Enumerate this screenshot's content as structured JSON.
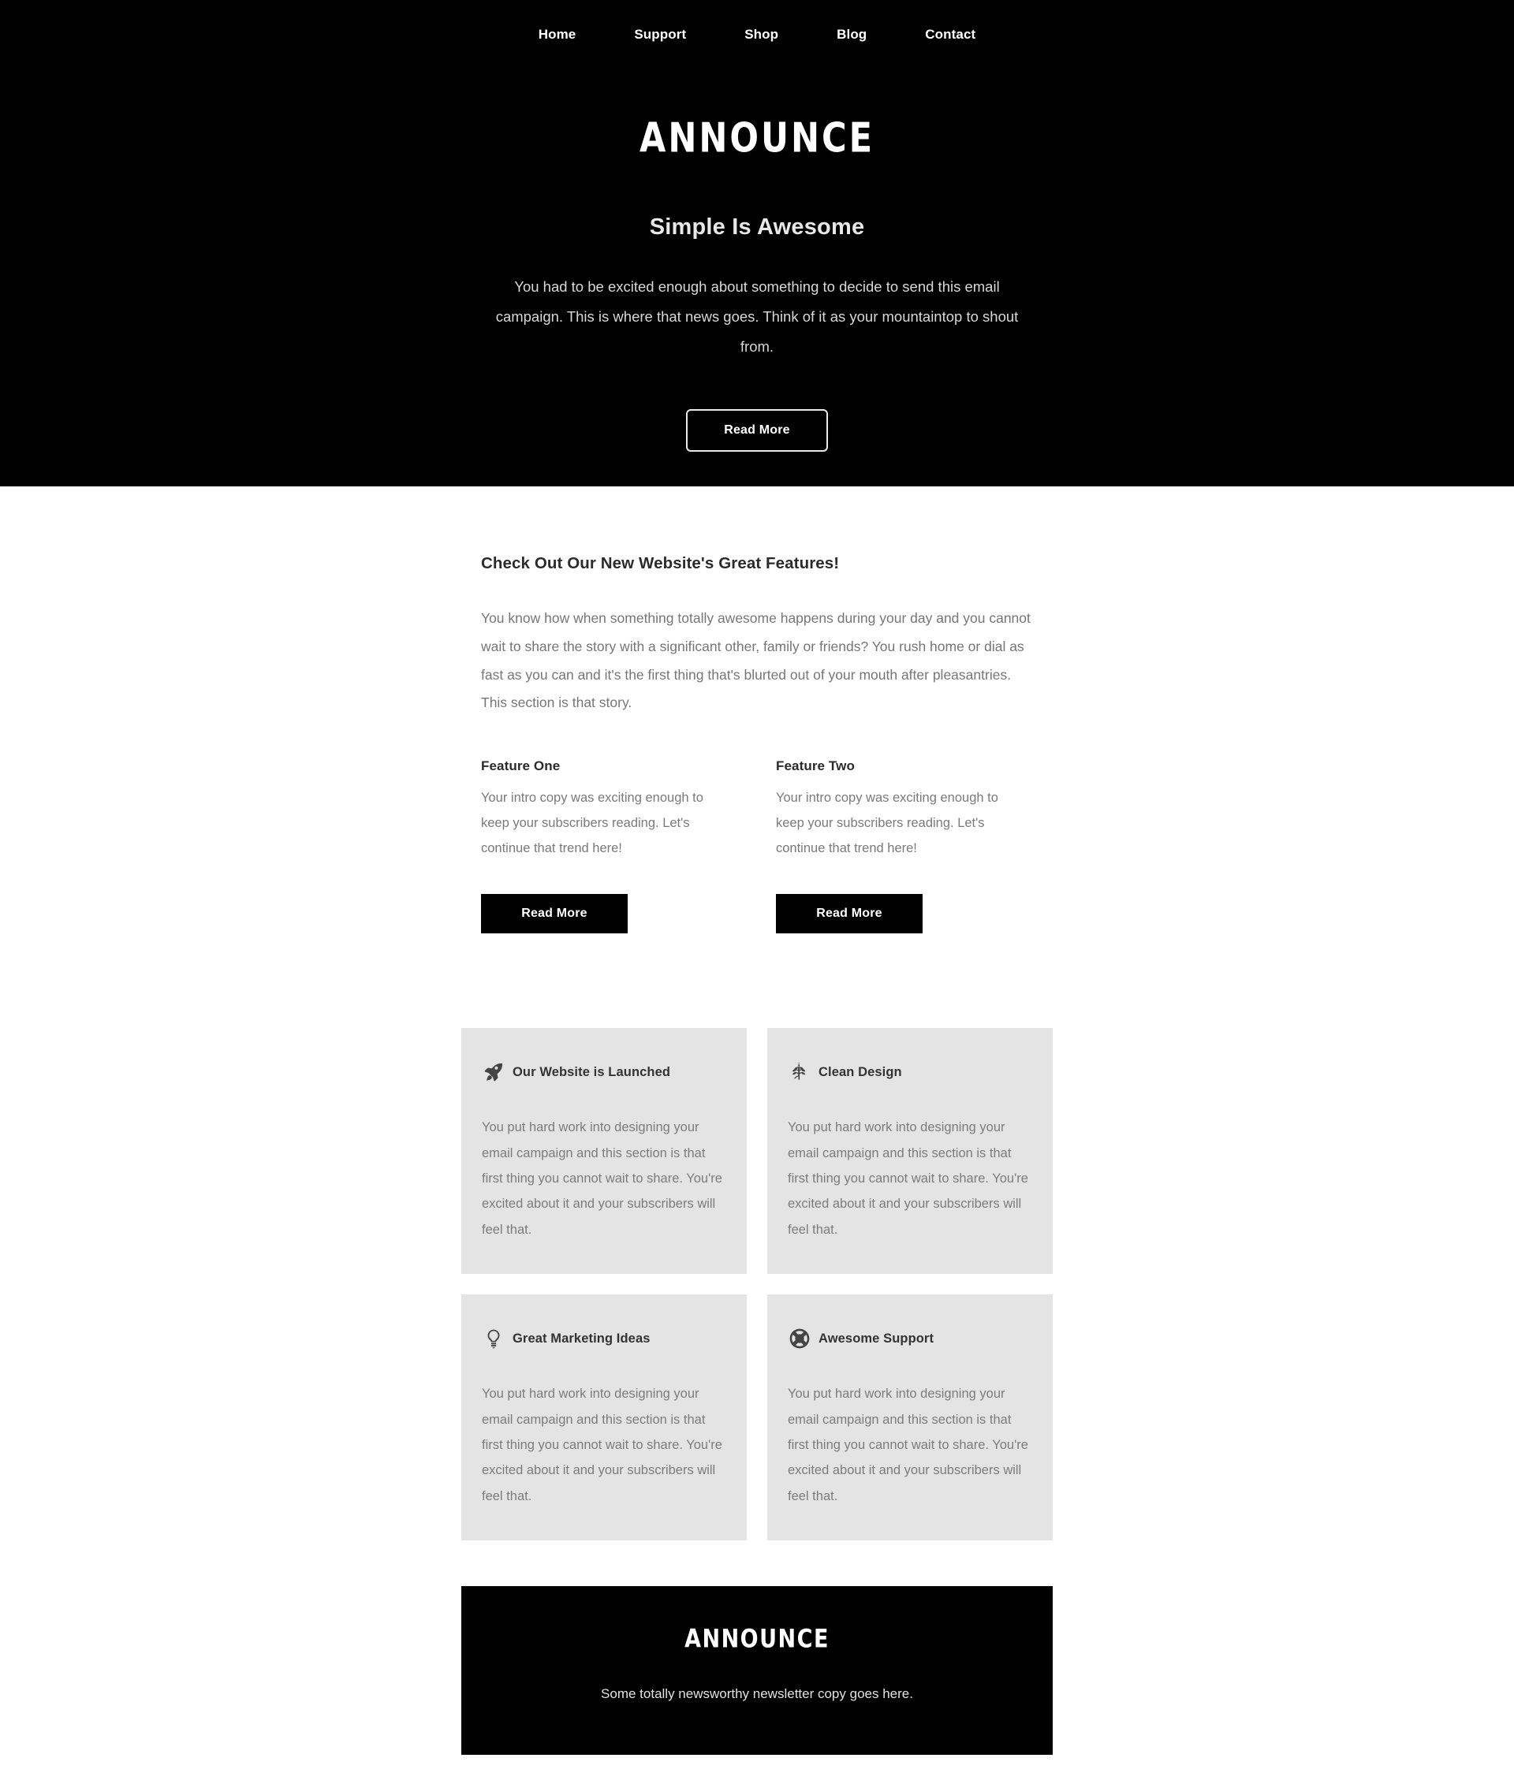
{
  "nav": {
    "items": [
      {
        "label": "Home"
      },
      {
        "label": "Support"
      },
      {
        "label": "Shop"
      },
      {
        "label": "Blog"
      },
      {
        "label": "Contact"
      }
    ]
  },
  "hero": {
    "logo": "ANNOUNCE",
    "title": "Simple Is Awesome",
    "body": "You had to be excited enough about something to decide to send this email campaign. This is where that news goes. Think of it as your mountaintop to shout from.",
    "button_label": "Read More",
    "background_color": "#000000",
    "text_color": "#ffffff"
  },
  "main": {
    "section_title": "Check Out Our New Website's Great Features!",
    "section_body": "You know how when something totally awesome happens during your day and you cannot wait to share the story with a significant other, family or friends? You rush home or dial as fast as you can and it's the first thing that's blurted out of your mouth after pleasantries. This section is that story.",
    "features": [
      {
        "title": "Feature One",
        "text": "Your intro copy was exciting enough to keep your subscribers reading. Let's continue that trend here!",
        "button_label": "Read More"
      },
      {
        "title": "Feature Two",
        "text": "Your intro copy was exciting enough to keep your subscribers reading. Let's continue that trend here!",
        "button_label": "Read More"
      }
    ]
  },
  "cards": [
    {
      "icon": "rocket-icon",
      "title": "Our Website is Launched",
      "body": "You put hard work into designing your email campaign and this section is that first thing you cannot wait to share. You're excited about it and your subscribers will feel that."
    },
    {
      "icon": "leaf-icon",
      "title": "Clean Design",
      "body": "You put hard work into designing your email campaign and this section is that first thing you cannot wait to share. You're excited about it and your subscribers will feel that."
    },
    {
      "icon": "lightbulb-icon",
      "title": "Great Marketing Ideas",
      "body": "You put hard work into designing your email campaign and this section is that first thing you cannot wait to share. You're excited about it and your subscribers will feel that."
    },
    {
      "icon": "lifebuoy-icon",
      "title": "Awesome Support",
      "body": "You put hard work into designing your email campaign and this section is that first thing you cannot wait to share. You're excited about it and your subscribers will feel that."
    }
  ],
  "footer": {
    "logo": "ANNOUNCE",
    "copy": "Some totally newsworthy newsletter copy goes here.",
    "background_color": "#000000"
  },
  "theme": {
    "card_background": "#e4e4e4",
    "body_text": "#7a7a7a",
    "heading_text": "#2b2b2b"
  }
}
